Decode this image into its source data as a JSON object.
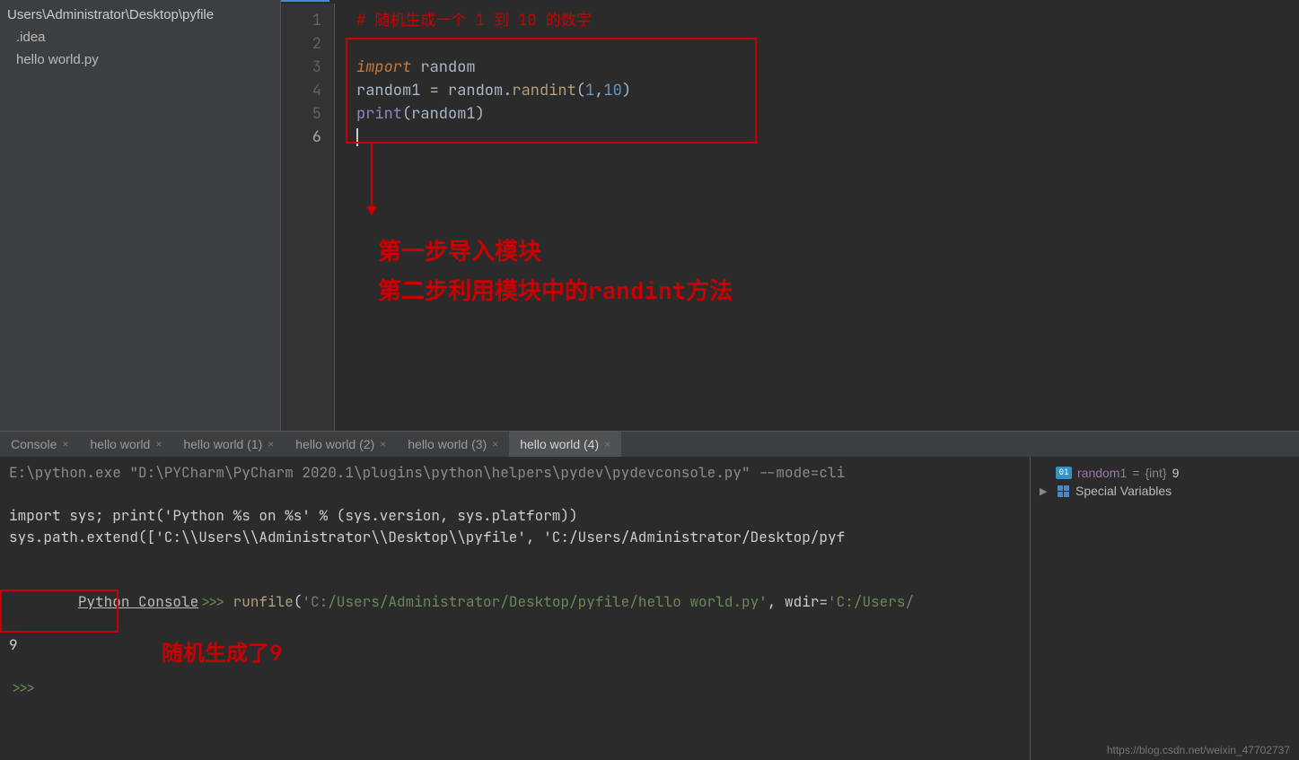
{
  "project": {
    "root_path": "Users\\Administrator\\Desktop\\pyfile",
    "items": [
      {
        "label": ".idea"
      },
      {
        "label": "hello world.py"
      }
    ]
  },
  "editor": {
    "lines": [
      "1",
      "2",
      "3",
      "4",
      "5",
      "6"
    ],
    "code": {
      "l1_comment": "# 随机生成一个 1 到 10 的数字",
      "l3_import": "import",
      "l3_module": " random",
      "l4_var": "random1 = random.",
      "l4_method": "randint",
      "l4_args_open": "(",
      "l4_n1": "1",
      "l4_comma": ",",
      "l4_n2": "10",
      "l4_args_close": ")",
      "l5_fn": "print",
      "l5_open": "(",
      "l5_arg": "random1",
      "l5_close": ")"
    },
    "annotations": {
      "step1": "第一步导入模块",
      "step2": "第二步利用模块中的randint方法"
    }
  },
  "console": {
    "tabs": [
      {
        "label": "Console",
        "closeable": true,
        "active": false
      },
      {
        "label": "hello world",
        "closeable": true,
        "active": false
      },
      {
        "label": "hello world (1)",
        "closeable": true,
        "active": false
      },
      {
        "label": "hello world (2)",
        "closeable": true,
        "active": false
      },
      {
        "label": "hello world (3)",
        "closeable": true,
        "active": false
      },
      {
        "label": "hello world (4)",
        "closeable": true,
        "active": true
      }
    ],
    "output": {
      "line1": "E:\\python.exe \"D:\\PYCharm\\PyCharm 2020.1\\plugins\\python\\helpers\\pydev\\pydevconsole.py\" --mode=cli",
      "line2": "import sys; print('Python %s on %s' % (sys.version, sys.platform))",
      "line3": "sys.path.extend(['C:\\\\Users\\\\Administrator\\\\Desktop\\\\pyfile', 'C:/Users/Administrator/Desktop/pyf",
      "pc_label": "Python Console",
      "prompt1": ">>> ",
      "run_fn": "runfile",
      "run_open": "(",
      "run_str1": "'C:/Users/Administrator/Desktop/pyfile/hello world.py'",
      "run_mid": ", wdir=",
      "run_str2": "'C:/Users/",
      "result": "9",
      "prompt2": ">>> "
    },
    "annotation": "随机生成了9"
  },
  "variables": {
    "items": [
      {
        "icon": "num",
        "name": "random1",
        "type": "{int}",
        "value": "9"
      },
      {
        "icon": "special",
        "name": "Special Variables"
      }
    ]
  },
  "watermark": "https://blog.csdn.net/weixin_47702737"
}
